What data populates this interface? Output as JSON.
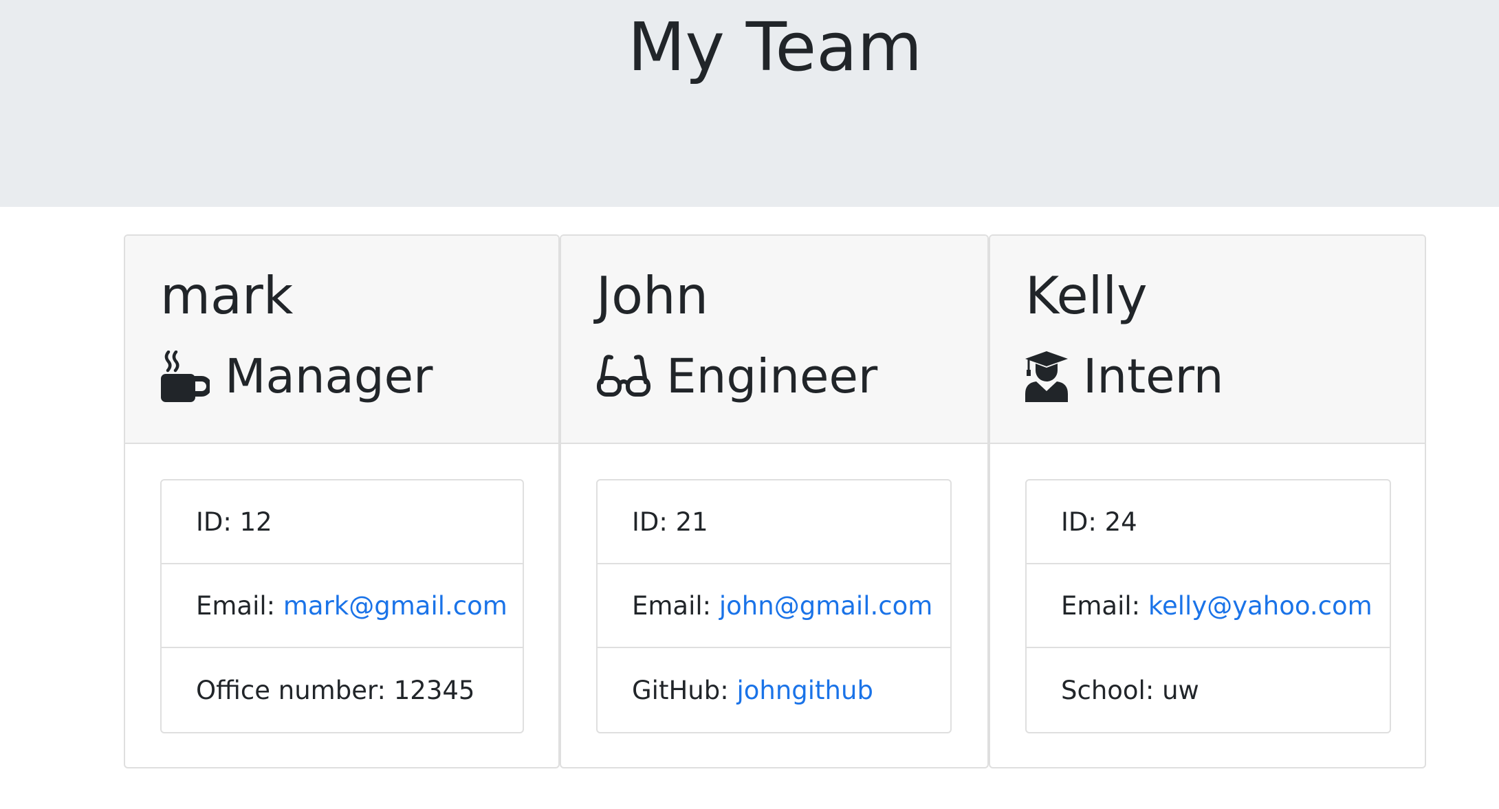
{
  "header": {
    "title": "My Team"
  },
  "labels": {
    "id": "ID: ",
    "email": "Email: ",
    "office": "Office number: ",
    "github": "GitHub: ",
    "school": "School: "
  },
  "employees": [
    {
      "name": "mark",
      "role": "Manager",
      "icon": "coffee-mug-icon",
      "id": "12",
      "email": "mark@gmail.com",
      "office_number": "12345"
    },
    {
      "name": "John",
      "role": "Engineer",
      "icon": "glasses-icon",
      "id": "21",
      "email": "john@gmail.com",
      "github": "johngithub"
    },
    {
      "name": "Kelly",
      "role": "Intern",
      "icon": "graduate-icon",
      "id": "24",
      "email": "kelly@yahoo.com",
      "school": "uw"
    }
  ],
  "colors": {
    "jumbotron": "#e9ecef",
    "header_bg": "#f7f7f7",
    "link": "#1a73e8",
    "text": "#212529",
    "border": "#dfdfdf"
  }
}
